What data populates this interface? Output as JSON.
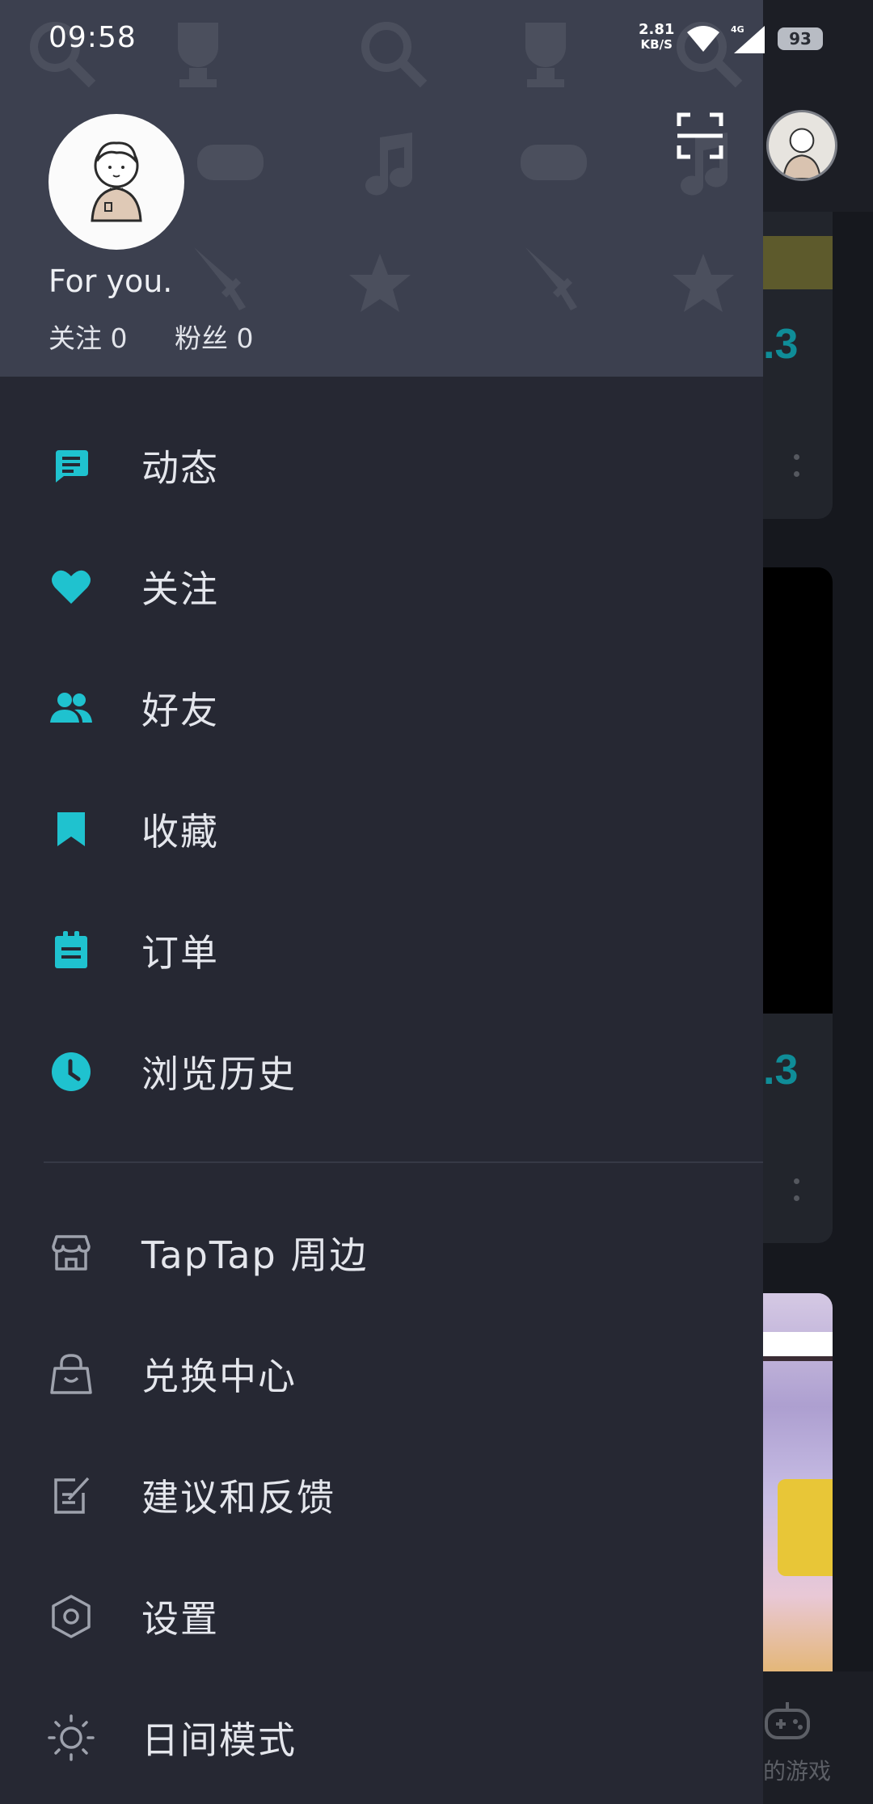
{
  "status_bar": {
    "time": "09:58",
    "net_speed_value": "2.81",
    "net_speed_unit": "KB/S",
    "signal_label": "4G",
    "battery": "93"
  },
  "profile": {
    "username": "For you.",
    "following_label": "关注 0",
    "followers_label": "粉丝 0"
  },
  "menu_primary": [
    {
      "label": "动态",
      "icon": "feed-icon"
    },
    {
      "label": "关注",
      "icon": "heart-icon"
    },
    {
      "label": "好友",
      "icon": "friends-icon"
    },
    {
      "label": "收藏",
      "icon": "bookmark-icon"
    },
    {
      "label": "订单",
      "icon": "clipboard-icon"
    },
    {
      "label": "浏览历史",
      "icon": "clock-icon"
    }
  ],
  "menu_secondary": [
    {
      "label": "TapTap 周边",
      "icon": "store-icon"
    },
    {
      "label": "兑换中心",
      "icon": "shopping-bag-icon"
    },
    {
      "label": "建议和反馈",
      "icon": "edit-icon"
    },
    {
      "label": "设置",
      "icon": "settings-hexagon-icon"
    },
    {
      "label": "日间模式",
      "icon": "sun-icon"
    }
  ],
  "background": {
    "score_1": ".3",
    "score_2": ".3",
    "nav_label": "的游戏"
  },
  "colors": {
    "accent": "#1fc2cf",
    "drawer_bg": "#262833",
    "header_bg": "#3c404f"
  }
}
